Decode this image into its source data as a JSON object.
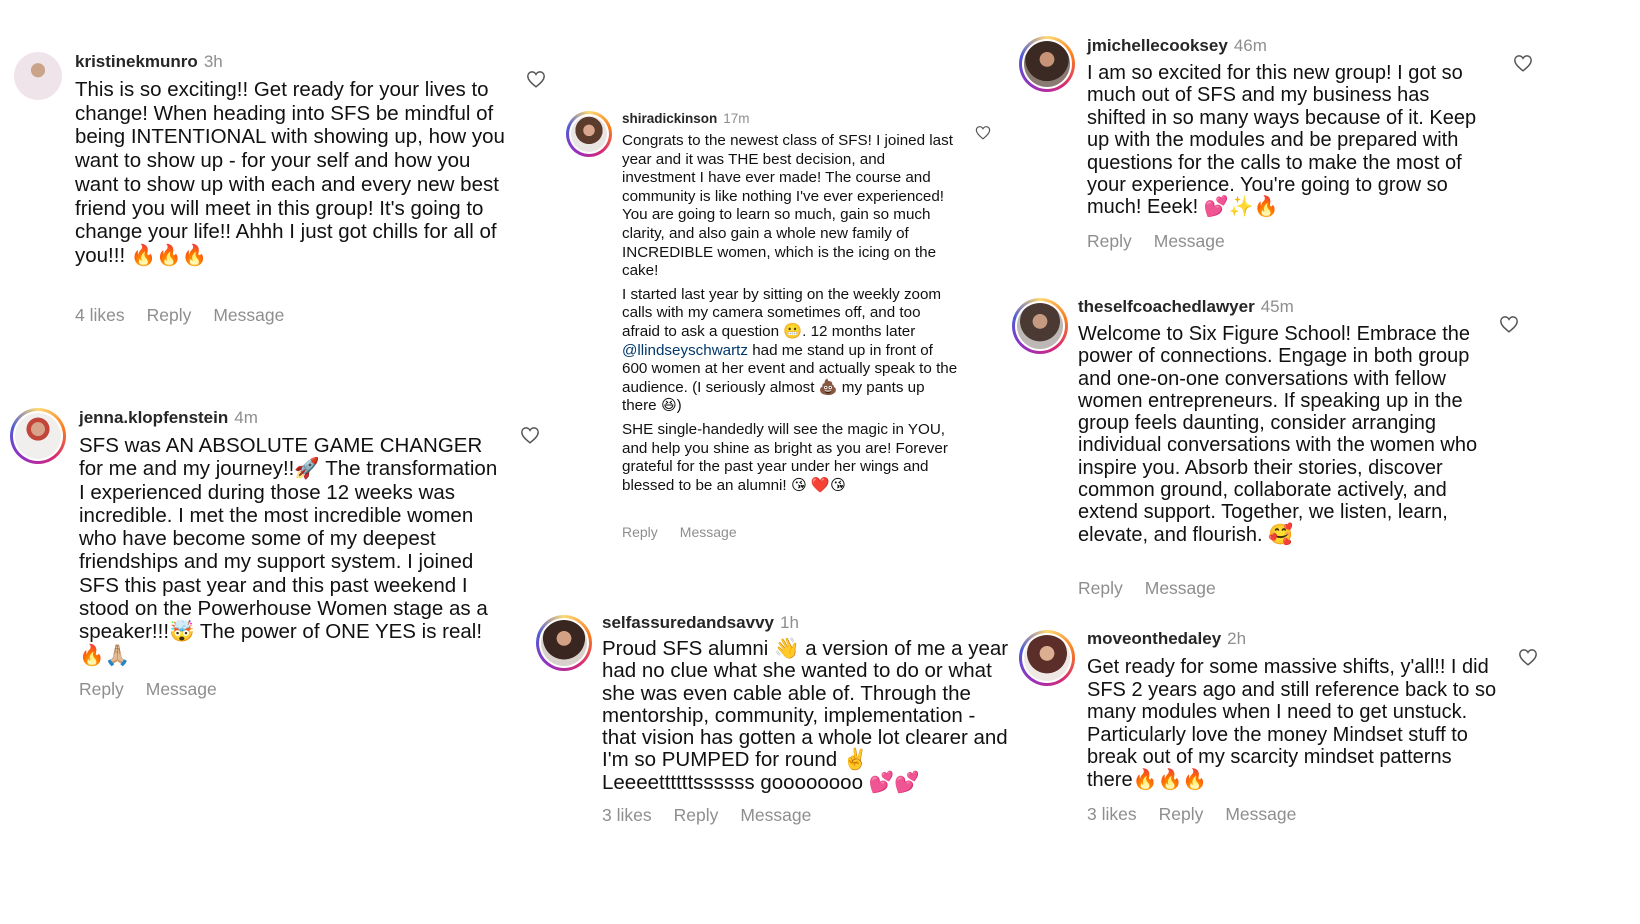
{
  "comments": [
    {
      "username": "kristinekmunro",
      "time": "3h",
      "text": "This is so exciting!! Get ready for your lives to change! When heading into SFS be mindful of being INTENTIONAL with showing up, how you want to show up - for your self and how you want to show up with each and every new best friend you will meet in this group! It's going to change your life!! Ahhh I just got chills for all of you!!! 🔥🔥🔥",
      "likes": "4 likes",
      "reply": "Reply",
      "message": "Message"
    },
    {
      "username": "jenna.klopfenstein",
      "time": "4m",
      "text": "SFS was AN ABSOLUTE GAME CHANGER for me and my journey!!🚀 The transformation I experienced during those 12 weeks was incredible. I met the most incredible women who have become some of my deepest friendships and my support system. I joined SFS this past year and this past weekend I stood on the Powerhouse Women stage as a speaker!!!🤯 The power of ONE YES is real!🔥🙏🏼",
      "reply": "Reply",
      "message": "Message"
    },
    {
      "username": "shiradickinson",
      "time": "17m",
      "paragraph1": "Congrats to the newest class of SFS! I joined last year and it was THE best decision, and investment I have ever made! The course and community is like nothing I've ever experienced! You are going to learn so much, gain so much clarity, and also gain a whole new family of INCREDIBLE women, which is the icing on the cake!",
      "paragraph2_before": "I started last year by sitting on the weekly zoom calls with my camera sometimes off, and too afraid to ask a question 😬. 12 months later ",
      "mention": "@llindseyschwartz",
      "paragraph2_after": " had me stand up in front of 600 women at her event and actually speak to the audience. (I seriously almost 💩 my pants up there 😆)",
      "paragraph3": "SHE single-handedly will see the magic in YOU, and help you shine as bright as you are! Forever grateful for the past year under her wings and blessed to be an alumni! 😘 ❤️😘",
      "reply": "Reply",
      "message": "Message"
    },
    {
      "username": "selfassuredandsavvy",
      "time": "1h",
      "text": "Proud SFS alumni 👋 a version of me a year had no clue what she wanted to do or what she was even cable able of. Through the mentorship, community, implementation - that vision has gotten a whole lot clearer and I'm so PUMPED for round ✌️ Leeeettttttssssss goooooooo 💕💕",
      "likes": "3 likes",
      "reply": "Reply",
      "message": "Message"
    },
    {
      "username": "jmichellecooksey",
      "time": "46m",
      "text": "I am so excited for this new group! I got so much out of SFS and my business has shifted in so many ways because of it. Keep up with the modules and be prepared with questions for the calls to make the most of your experience. You're going to grow so much! Eeek! 💕✨🔥",
      "reply": "Reply",
      "message": "Message"
    },
    {
      "username": "theselfcoachedlawyer",
      "time": "45m",
      "text": "Welcome to Six Figure School! Embrace the power of connections. Engage in both group and one-on-one conversations with fellow women entrepreneurs. If speaking up in the group feels daunting, consider arranging individual conversations with the women who inspire you. Absorb their stories, discover common ground, collaborate actively, and extend support. Together, we listen, learn, elevate, and flourish. 🥰",
      "reply": "Reply",
      "message": "Message"
    },
    {
      "username": "moveonthedaley",
      "time": "2h",
      "text": "Get ready for some massive shifts, y'all!! I did SFS 2 years ago and still reference back to so many modules when I need to get unstuck. Particularly love the money Mindset stuff to break out of my scarcity mindset patterns there🔥🔥🔥",
      "likes": "3 likes",
      "reply": "Reply",
      "message": "Message"
    }
  ]
}
